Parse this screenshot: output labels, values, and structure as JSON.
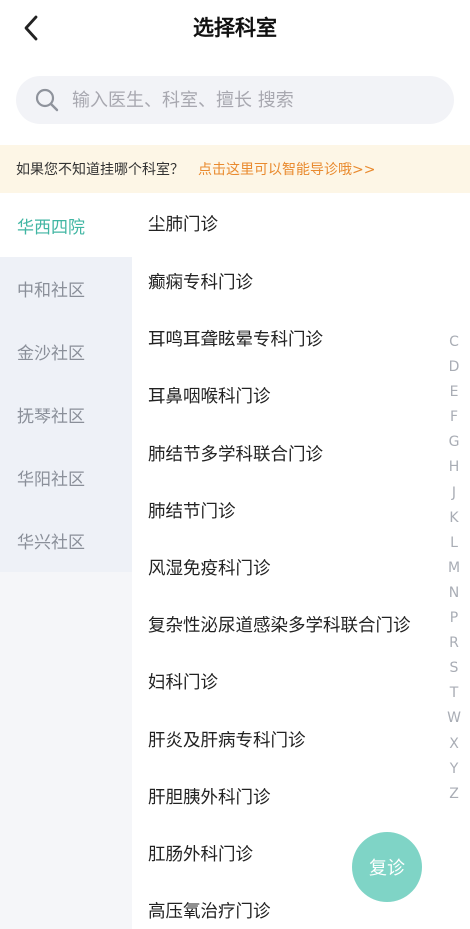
{
  "header": {
    "back_icon": "chevron-left-icon",
    "title": "选择科室"
  },
  "search": {
    "icon": "search-icon",
    "placeholder": "输入医生、科室、擅长 搜索",
    "value": ""
  },
  "notice": {
    "text": "如果您不知道挂哪个科室？",
    "link": "点击这里可以智能导诊哦>>",
    "background": "#fdf6e6",
    "link_color": "#e98a2e"
  },
  "sidebar": {
    "active_color": "#41b6a3",
    "items": [
      {
        "label": "华西四院",
        "active": true
      },
      {
        "label": "中和社区",
        "active": false
      },
      {
        "label": "金沙社区",
        "active": false
      },
      {
        "label": "抚琴社区",
        "active": false
      },
      {
        "label": "华阳社区",
        "active": false
      },
      {
        "label": "华兴社区",
        "active": false
      }
    ]
  },
  "departments": [
    "尘肺门诊",
    "癫痫专科门诊",
    "耳鸣耳聋眩晕专科门诊",
    "耳鼻咽喉科门诊",
    "肺结节多学科联合门诊",
    "肺结节门诊",
    "风湿免疫科门诊",
    "复杂性泌尿道感染多学科联合门诊",
    "妇科门诊",
    "肝炎及肝病专科门诊",
    "肝胆胰外科门诊",
    "肛肠外科门诊",
    "高压氧治疗门诊"
  ],
  "alphabet_index": [
    "C",
    "D",
    "E",
    "F",
    "G",
    "H",
    "J",
    "K",
    "L",
    "M",
    "N",
    "P",
    "R",
    "S",
    "T",
    "W",
    "X",
    "Y",
    "Z"
  ],
  "fab": {
    "label": "复诊",
    "color": "#7fd4c6"
  }
}
